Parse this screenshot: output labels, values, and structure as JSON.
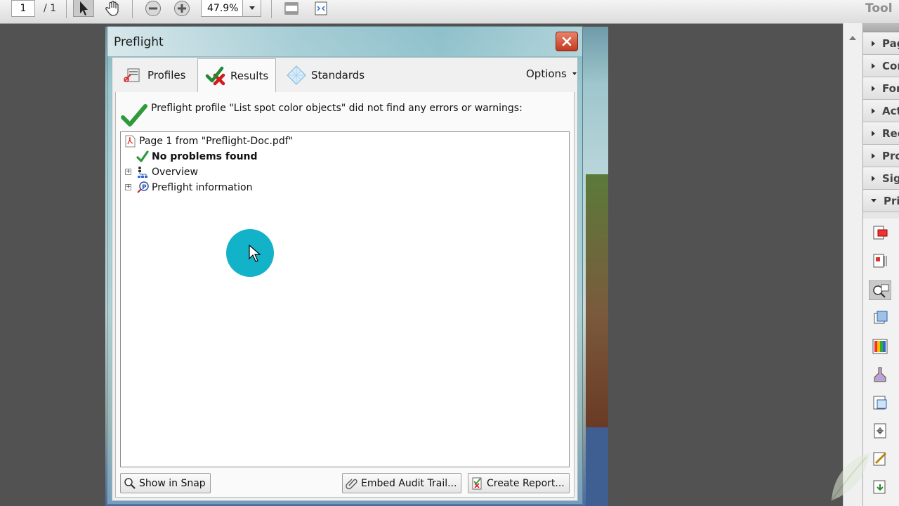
{
  "toolbar": {
    "page_current": "1",
    "page_total": "/ 1",
    "zoom_value": "47.9%",
    "tools_label": "Tool",
    "icons": [
      "select-arrow-icon",
      "hand-icon",
      "zoom-out-icon",
      "zoom-in-icon",
      "fit-page-icon",
      "fit-width-icon"
    ]
  },
  "tools_pane": {
    "rows": [
      {
        "label": "Pag",
        "open": false
      },
      {
        "label": "Cor",
        "open": false
      },
      {
        "label": "For",
        "open": false
      },
      {
        "label": "Act",
        "open": false
      },
      {
        "label": "Rec",
        "open": false
      },
      {
        "label": "Pro",
        "open": false
      },
      {
        "label": "Sig",
        "open": false
      },
      {
        "label": "Pri",
        "open": true
      }
    ]
  },
  "dialog": {
    "title": "Preflight",
    "tabs": {
      "profiles": "Profiles",
      "results": "Results",
      "standards": "Standards"
    },
    "options": "Options",
    "summary": "Preflight profile \"List spot color objects\" did not find any errors or warnings:",
    "tree": {
      "root": "Page 1 from \"Preflight-Doc.pdf\"",
      "no_problems": "No problems found",
      "overview": "Overview",
      "preflight_info": "Preflight information"
    },
    "buttons": {
      "show_in_snap": "Show in Snap",
      "embed_audit_trail": "Embed Audit Trail...",
      "create_report": "Create Report..."
    }
  },
  "colors": {
    "accent_check": "#2e9a3a",
    "close_red": "#c3391f",
    "cursor_highlight": "#12b3c9"
  }
}
